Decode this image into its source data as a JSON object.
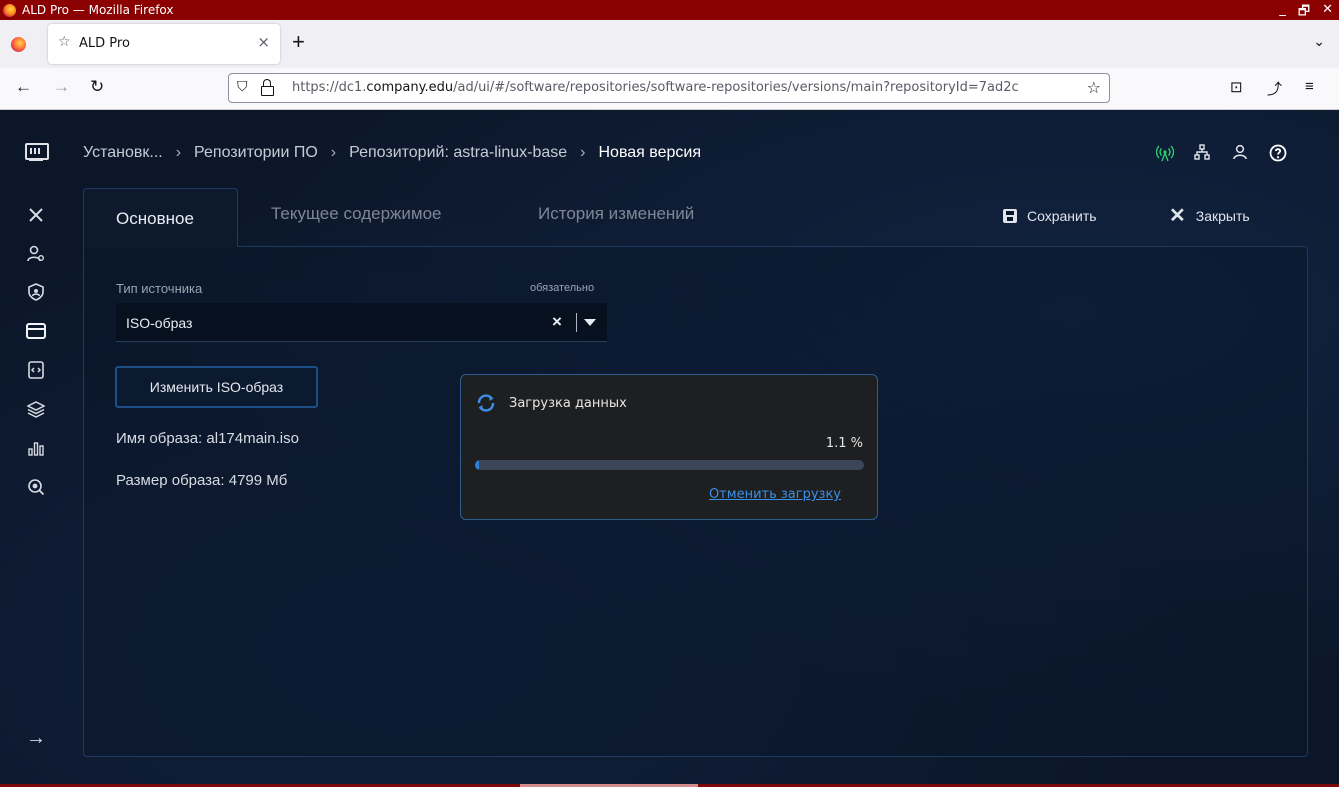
{
  "os_window": {
    "title": "ALD Pro — Mozilla Firefox",
    "controls": [
      "_",
      "🗗",
      "✕"
    ]
  },
  "browser": {
    "tab_title": "ALD Pro",
    "tab_close": "×",
    "new_tab": "+",
    "tab_list": "⌄",
    "back": "←",
    "forward": "→",
    "reload": "↻",
    "url_prefix": "https://dc1.",
    "url_host": "company.edu",
    "url_path": "/ad/ui/#/software/repositories/software-repositories/versions/main?repositoryId=7ad2c",
    "bookmark_star": "☆",
    "pocket": "⊡",
    "extensions": "⤴",
    "menu": "≡"
  },
  "app": {
    "breadcrumb": [
      {
        "label": "Установк..."
      },
      {
        "label": "Репозитории ПО"
      },
      {
        "label": "Репозиторий: astra-linux-base"
      },
      {
        "label": "Новая версия"
      }
    ],
    "breadcrumb_separator": "›",
    "header_icons": [
      "network-status-icon",
      "topology-icon",
      "user-icon",
      "help-icon"
    ],
    "rail_icons": [
      "logo-icon",
      "tools-icon",
      "users-settings-icon",
      "shield-icon",
      "window-icon",
      "code-file-icon",
      "layers-icon",
      "bar-chart-icon",
      "search-zoom-icon",
      "expand-arrow-icon"
    ],
    "tabs": [
      {
        "label": "Основное",
        "active": true
      },
      {
        "label": "Текущее содержимое",
        "active": false
      },
      {
        "label": "История изменений",
        "active": false
      }
    ],
    "actions": {
      "save_label": "Сохранить",
      "close_label": "Закрыть"
    },
    "form": {
      "source_type_label": "Тип источника",
      "required_label": "обязательно",
      "source_type_value": "ISO-образ",
      "change_iso_label": "Изменить ISO-образ",
      "image_name": "Имя образа: al174main.iso",
      "image_size": "Размер образа: 4799 Мб"
    },
    "loading_dialog": {
      "title": "Загрузка данных",
      "percent_text": "1.1 %",
      "progress": 0.011,
      "cancel_label": "Отменить загрузку"
    }
  },
  "colors": {
    "os_titlebar": "#8b0000",
    "app_bg": "#0b1628",
    "accent_blue": "#2d7fd6",
    "link_blue": "#3b8fe6",
    "status_green": "#2ecc71"
  }
}
